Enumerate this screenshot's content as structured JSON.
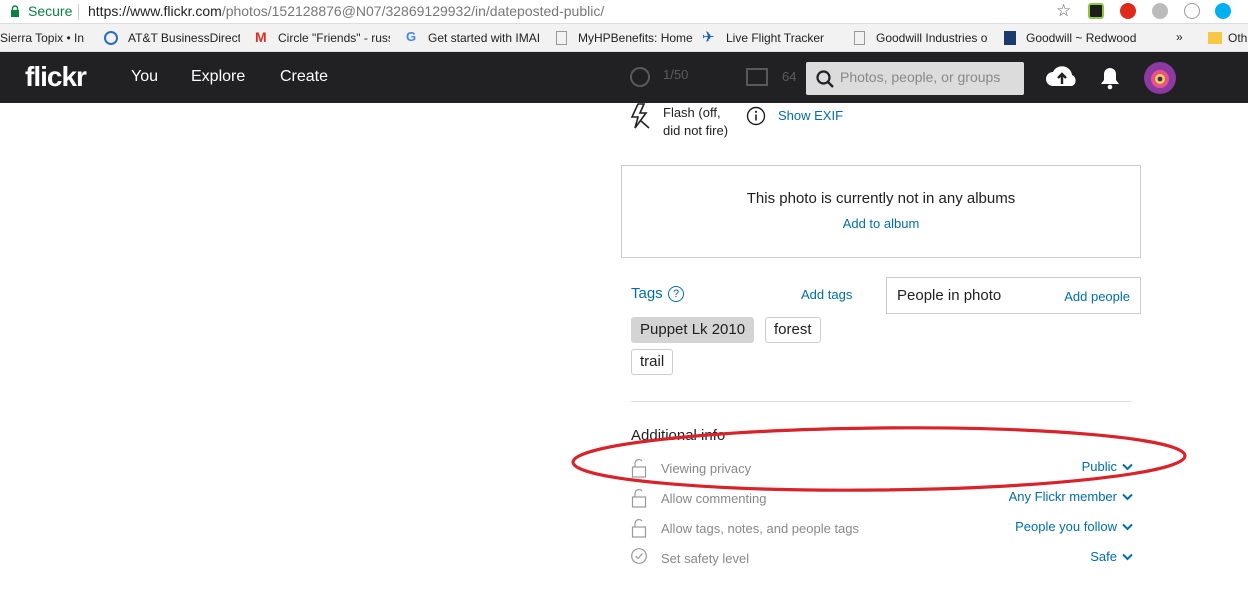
{
  "browser": {
    "secure_label": "Secure",
    "url_host": "https://www.flickr.com",
    "url_path": "/photos/152128876@N07/32869129932/in/dateposted-public/",
    "bookmarks": [
      {
        "label": "Sierra Topix • In"
      },
      {
        "label": "AT&T BusinessDirect"
      },
      {
        "label": "Circle \"Friends\" - russ"
      },
      {
        "label": "Get started with IMAI"
      },
      {
        "label": "MyHPBenefits: Home"
      },
      {
        "label": "Live Flight Tracker"
      },
      {
        "label": "Goodwill Industries o"
      },
      {
        "label": "Goodwill ~ Redwood"
      },
      {
        "label": "»"
      },
      {
        "label": "Oth"
      }
    ]
  },
  "nav": {
    "logo": "flickr",
    "links": [
      "You",
      "Explore",
      "Create"
    ],
    "search_placeholder": "Photos, people, or groups"
  },
  "exif": {
    "faded_shutter": "1/50",
    "faded_iso": "64",
    "flash_line1": "Flash (off,",
    "flash_line2": "did not fire)",
    "show_exif": "Show EXIF"
  },
  "albums": {
    "message": "This photo is currently not in any albums",
    "add_label": "Add to album"
  },
  "tags": {
    "title": "Tags",
    "add_label": "Add tags",
    "items": [
      "Puppet Lk 2010",
      "forest",
      "trail"
    ]
  },
  "people": {
    "title": "People in photo",
    "add_label": "Add people"
  },
  "additional_info": {
    "title": "Additional info",
    "settings": [
      {
        "label": "Viewing privacy",
        "value": "Public"
      },
      {
        "label": "Allow commenting",
        "value": "Any Flickr member"
      },
      {
        "label": "Allow tags, notes, and people tags",
        "value": "People you follow"
      },
      {
        "label": "Set safety level",
        "value": "Safe"
      }
    ]
  },
  "colors": {
    "link": "#006dac",
    "nav_bg": "#212124",
    "annotation": "#d9232a"
  }
}
